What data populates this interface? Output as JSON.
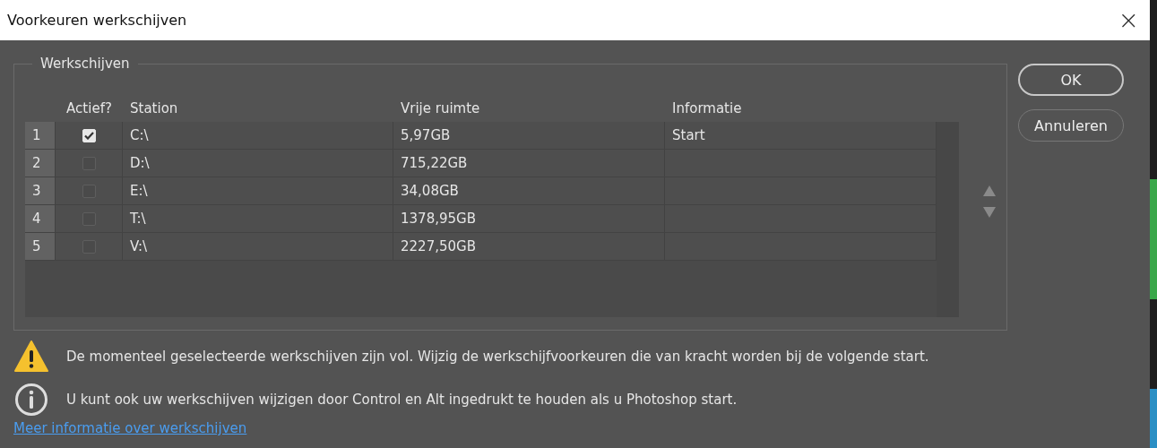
{
  "window": {
    "title": "Voorkeuren werkschijven",
    "close": "×"
  },
  "group": {
    "title": "Werkschijven"
  },
  "table": {
    "columns": [
      "Actief?",
      "Station",
      "Vrije ruimte",
      "Informatie"
    ],
    "rows": [
      {
        "index": "1",
        "checked": true,
        "station": "C:\\",
        "free": "5,97GB",
        "info": "Start"
      },
      {
        "index": "2",
        "checked": false,
        "station": "D:\\",
        "free": "715,22GB",
        "info": ""
      },
      {
        "index": "3",
        "checked": false,
        "station": "E:\\",
        "free": "34,08GB",
        "info": ""
      },
      {
        "index": "4",
        "checked": false,
        "station": "T:\\",
        "free": "1378,95GB",
        "info": ""
      },
      {
        "index": "5",
        "checked": false,
        "station": "V:\\",
        "free": "2227,50GB",
        "info": ""
      }
    ]
  },
  "buttons": [
    {
      "label": "OK",
      "kind": "default"
    },
    {
      "label": "Annuleren",
      "kind": "normal"
    }
  ],
  "messages": [
    {
      "kind": "warning",
      "text": "De momenteel geselecteerde werkschijven zijn vol. Wijzig de werkschijfvoorkeuren die van kracht worden bij de volgende start."
    },
    {
      "kind": "info",
      "text": "U kunt ook uw werkschijven wijzigen door Control en Alt ingedrukt te houden als u Photoshop start."
    }
  ],
  "link": "Meer informatie over werkschijven"
}
